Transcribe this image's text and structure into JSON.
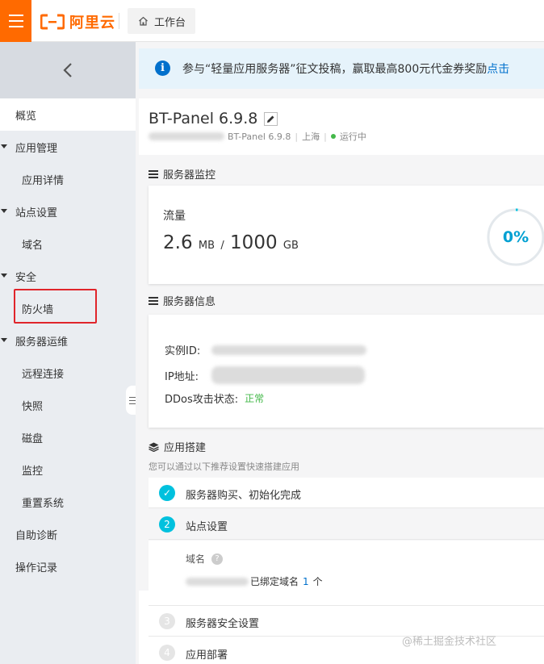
{
  "topbar": {
    "brand_text": "阿里云",
    "workbench_label": "工作台",
    "brand_color": "#ff6a00"
  },
  "sidebar": {
    "items": [
      {
        "label": "概览",
        "level": "top",
        "active": true
      },
      {
        "label": "应用管理",
        "level": "group"
      },
      {
        "label": "应用详情",
        "level": "sub"
      },
      {
        "label": "站点设置",
        "level": "group"
      },
      {
        "label": "域名",
        "level": "sub"
      },
      {
        "label": "安全",
        "level": "group"
      },
      {
        "label": "防火墙",
        "level": "sub",
        "highlighted": true
      },
      {
        "label": "服务器运维",
        "level": "group"
      },
      {
        "label": "远程连接",
        "level": "sub"
      },
      {
        "label": "快照",
        "level": "sub"
      },
      {
        "label": "磁盘",
        "level": "sub"
      },
      {
        "label": "监控",
        "level": "sub"
      },
      {
        "label": "重置系统",
        "level": "sub"
      },
      {
        "label": "自助诊断",
        "level": "top"
      },
      {
        "label": "操作记录",
        "level": "top"
      }
    ]
  },
  "notice": {
    "text": "参与“轻量应用服务器”征文投稿，赢取最高800元代金券奖励",
    "link_text": "点击"
  },
  "instance": {
    "title": "BT-Panel 6.9.8",
    "image": "BT-Panel 6.9.8",
    "region": "上海",
    "status": "运行中"
  },
  "monitor": {
    "section_title": "服务器监控",
    "traffic_label": "流量",
    "traffic_used": "2.6",
    "traffic_used_unit": "MB",
    "slash": "/",
    "traffic_total": "1000",
    "traffic_total_unit": "GB",
    "usage_percent_text": "0%",
    "usage_fraction": 0.0
  },
  "server_info": {
    "section_title": "服务器信息",
    "instance_id_label": "实例ID:",
    "ip_label": "IP地址:",
    "ddos_label": "DDos攻击状态:",
    "ddos_status": "正常"
  },
  "app_build": {
    "section_title": "应用搭建",
    "hint": "您可以通过以下推荐设置快速搭建应用",
    "steps": [
      {
        "num": "✓",
        "label": "服务器购买、初始化完成",
        "state": "done"
      },
      {
        "num": "2",
        "label": "站点设置",
        "state": "current"
      },
      {
        "num": "3",
        "label": "服务器安全设置",
        "state": "todo"
      },
      {
        "num": "4",
        "label": "应用部署",
        "state": "todo"
      }
    ],
    "domain": {
      "label": "域名",
      "help": "?",
      "bound_prefix": "已绑定域名",
      "bound_count": "1",
      "bound_suffix": "个"
    }
  },
  "watermark": "@稀土掘金技术社区",
  "colors": {
    "accent_orange": "#ff6a00",
    "link_blue": "#0070cc",
    "step_cyan": "#00c1de",
    "ok_green": "#43b849",
    "highlight_red": "#e0252b"
  }
}
